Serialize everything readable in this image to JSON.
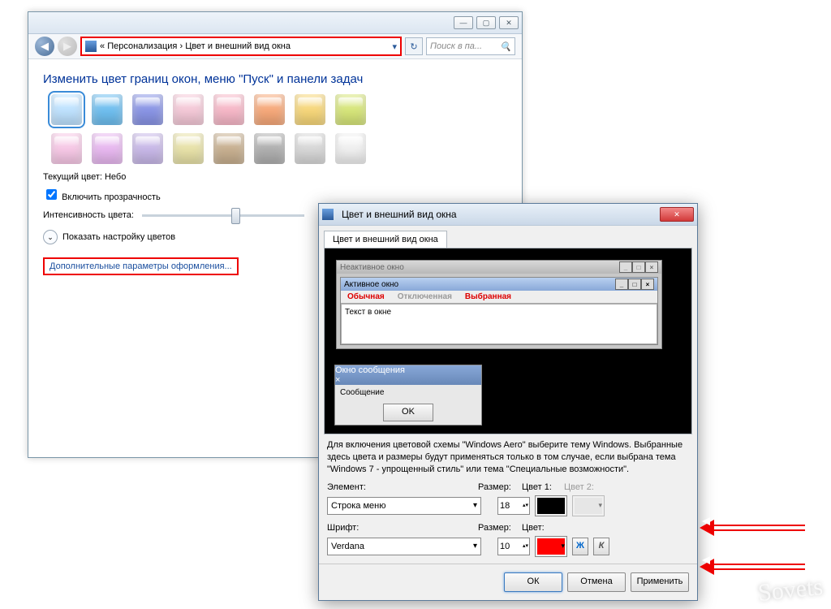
{
  "main": {
    "breadcrumb_prefix": "«",
    "breadcrumb_1": "Персонализация",
    "breadcrumb_sep": "›",
    "breadcrumb_2": "Цвет и внешний вид окна",
    "search_placeholder": "Поиск в па...",
    "heading": "Изменить цвет границ окон, меню \"Пуск\" и панели задач",
    "colors_row1": [
      "#bfe3ff",
      "#6fbff0",
      "#8a95e6",
      "#f5c9d8",
      "#f7b8c8",
      "#f7a97a",
      "#f7d77a",
      "#d7e67a"
    ],
    "colors_row2": [
      "#f7c8e6",
      "#e8b8f0",
      "#c8b8e8",
      "#e8e2a8",
      "#c8b090",
      "#b0b0b0",
      "#d8d8d8",
      "#f0f0f0"
    ],
    "current_color_label": "Текущий цвет:",
    "current_color_value": "Небо",
    "enable_transparency": "Включить прозрачность",
    "intensity_label": "Интенсивность цвета:",
    "show_mixer": "Показать настройку цветов",
    "advanced_link": "Дополнительные параметры оформления..."
  },
  "dlg": {
    "title": "Цвет и внешний вид окна",
    "tab": "Цвет и внешний вид окна",
    "preview": {
      "inactive": "Неактивное окно",
      "active": "Активное окно",
      "normal": "Обычная",
      "disabled": "Отключенная",
      "selected": "Выбранная",
      "text_in_window": "Текст в окне",
      "msg_title": "Окно сообщения",
      "msg_body": "Сообщение",
      "ok": "OK"
    },
    "info": "Для включения цветовой схемы \"Windows Aero\" выберите тему Windows. Выбранные здесь цвета и размеры будут применяться только в том случае, если выбрана тема \"Windows 7 - упрощенный стиль\" или тема \"Специальные возможности\".",
    "element_label": "Элемент:",
    "element_value": "Строка меню",
    "size_label": "Размер:",
    "size_value": "18",
    "color1_label": "Цвет 1:",
    "color2_label": "Цвет 2:",
    "color1_value": "#000000",
    "font_label": "Шрифт:",
    "font_value": "Verdana",
    "font_size_label": "Размер:",
    "font_size_value": "10",
    "font_color_label": "Цвет:",
    "font_color_value": "#ff0000",
    "bold": "Ж",
    "italic": "К",
    "ok": "ОК",
    "cancel": "Отмена",
    "apply": "Применить"
  },
  "watermark": "Sovets"
}
